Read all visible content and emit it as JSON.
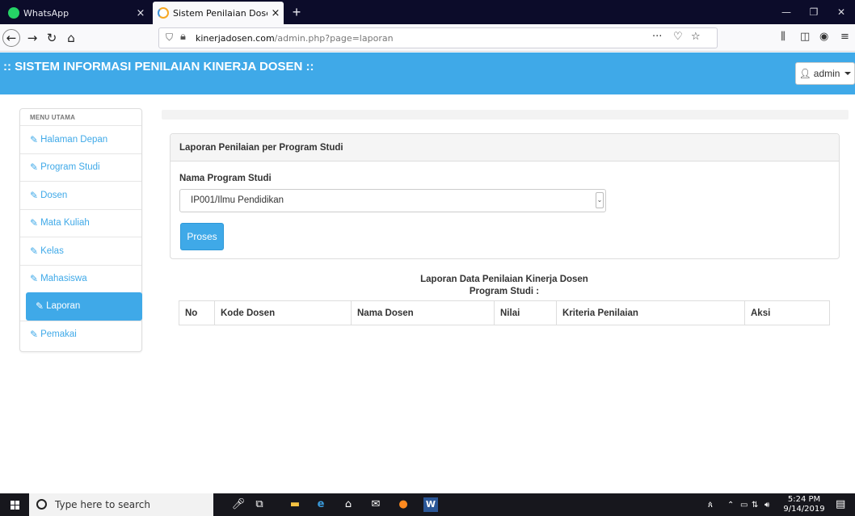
{
  "browser": {
    "tabs": [
      {
        "label": "WhatsApp",
        "icon": "whatsapp-icon"
      },
      {
        "label": "Sistem Penilaian Dosen",
        "icon": "site-favicon-icon"
      }
    ],
    "close_glyph": "×",
    "new_tab_glyph": "+",
    "url_domain": "kinerjadosen.com",
    "url_path": "/admin.php?page=laporan",
    "url_more_glyph": "···"
  },
  "app": {
    "title": ":: SISTEM INFORMASI PENILAIAN KINERJA DOSEN ::",
    "user_label": "admin",
    "accent_color": "#3fa9e8"
  },
  "sidebar": {
    "heading": "MENU UTAMA",
    "items": [
      {
        "label": "Halaman Depan"
      },
      {
        "label": "Program Studi"
      },
      {
        "label": "Dosen"
      },
      {
        "label": "Mata Kuliah"
      },
      {
        "label": "Kelas"
      },
      {
        "label": "Mahasiswa"
      },
      {
        "label": "Laporan",
        "active": true
      },
      {
        "label": "Pemakai"
      }
    ]
  },
  "form": {
    "panel_title": "Laporan Penilaian per Program Studi",
    "field_label": "Nama Program Studi",
    "selected_value": "IP001/Ilmu Pendidikan",
    "submit_label": "Proses"
  },
  "report": {
    "title": "Laporan Data Penilaian Kinerja Dosen",
    "subtitle": "Program Studi :",
    "columns": [
      "No",
      "Kode Dosen",
      "Nama Dosen",
      "Nilai",
      "Kriteria Penilaian",
      "Aksi"
    ]
  },
  "taskbar": {
    "search_placeholder": "Type here to search",
    "time": "5:24 PM",
    "date": "9/14/2019"
  }
}
